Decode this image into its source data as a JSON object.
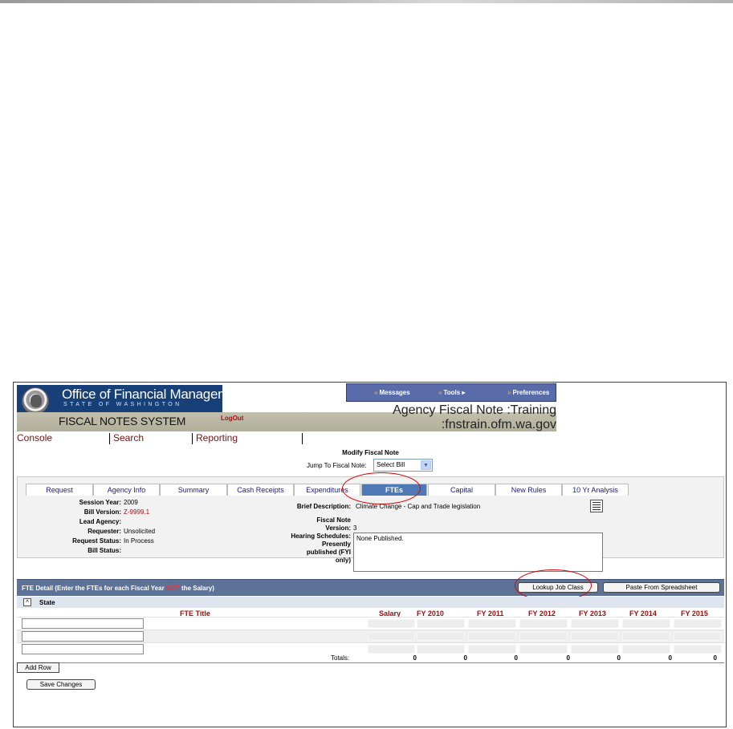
{
  "header": {
    "org_title": "Office of Financial Management",
    "org_sub": "STATE OF WASHINGTON",
    "system_title": "FISCAL NOTES SYSTEM",
    "logout": "LogOut",
    "environment": "Agency Fiscal Note :Training :fnstrain.ofm.wa.gov"
  },
  "topmenu": {
    "messages": "Messages",
    "tools": "Tools",
    "preferences": "Preferences"
  },
  "nav": {
    "console": "Console",
    "search": "Search",
    "reporting": "Reporting"
  },
  "form": {
    "title": "Modify Fiscal Note",
    "jump_label": "Jump To Fiscal Note:",
    "jump_value": "Select Bill"
  },
  "tabs": [
    {
      "label": "Request"
    },
    {
      "label": "Agency Info"
    },
    {
      "label": "Summary"
    },
    {
      "label": "Cash Receipts"
    },
    {
      "label": "Expenditures"
    },
    {
      "label": "FTEs"
    },
    {
      "label": "Capital"
    },
    {
      "label": "New Rules"
    },
    {
      "label": "10 Yr Analysis"
    }
  ],
  "info": {
    "session_year_label": "Session Year:",
    "session_year": "2009",
    "bill_version_label": "Bill Version:",
    "bill_version": "Z-9999.1",
    "lead_agency_label": "Lead Agency:",
    "requester_label": "Requester:",
    "requester": "Unsolicited",
    "request_status_label": "Request Status:",
    "request_status": "In Process",
    "bill_status_label": "Bill Status:",
    "brief_label": "Brief Description:",
    "brief": "Climate Change - Cap and Trade legislation",
    "fn_version_label_1": "Fiscal Note",
    "fn_version_label_2": "Version:",
    "fn_version": "3",
    "hearing_label_1": "Hearing Schedules:",
    "hearing_label_2": "Presently",
    "hearing_label_3": "published (FYI",
    "hearing_label_4": "only)",
    "hearing_value": "None Published."
  },
  "fte": {
    "bar_label_pre": "FTE Detail (Enter the FTEs for each Fiscal Year ",
    "bar_label_not": "NOT",
    "bar_label_post": " the Salary)",
    "lookup_button": "Lookup Job Class",
    "paste_button": "Paste From Spreadsheet",
    "state_toggle": "˄",
    "state_label": "State",
    "columns": [
      "FTE Title",
      "Salary",
      "FY 2010",
      "FY 2011",
      "FY 2012",
      "FY 2013",
      "FY 2014",
      "FY 2015"
    ],
    "totals_label": "Totals:",
    "totals": [
      "0",
      "0",
      "0",
      "0",
      "0",
      "0",
      "0"
    ],
    "add_row": "Add Row"
  },
  "save_button": "Save Changes",
  "colors": {
    "highlight": "#e00000",
    "banner": "#173f78",
    "fte_bar": "#5e7297",
    "accent_text": "#a01010"
  }
}
